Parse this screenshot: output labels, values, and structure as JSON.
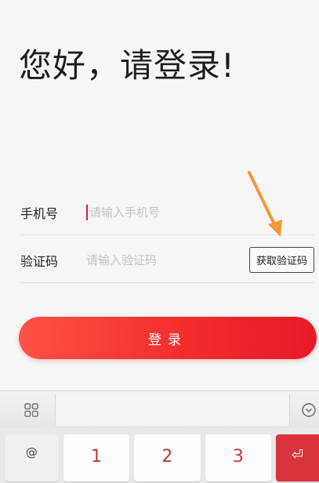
{
  "page": {
    "greeting": "您好，请登录!"
  },
  "form": {
    "phone": {
      "label": "手机号",
      "placeholder": "请输入手机号",
      "value": ""
    },
    "code": {
      "label": "验证码",
      "placeholder": "请输入验证码",
      "value": "",
      "get_code_label": "获取验证码"
    }
  },
  "actions": {
    "login_label": "登录"
  },
  "keyboard": {
    "toolbar_icons": [
      "grid-icon",
      "chevron-down-icon"
    ],
    "keys": [
      {
        "label": "@",
        "type": "symbol"
      },
      {
        "label": "1",
        "type": "number"
      },
      {
        "label": "2",
        "type": "number"
      },
      {
        "label": "3",
        "type": "number"
      },
      {
        "label": "⏎",
        "type": "enter"
      }
    ]
  },
  "colors": {
    "accent": "#f12b2b",
    "caret": "#d81f4e",
    "arrow": "#f39a35",
    "enter_key": "#d9343c"
  }
}
